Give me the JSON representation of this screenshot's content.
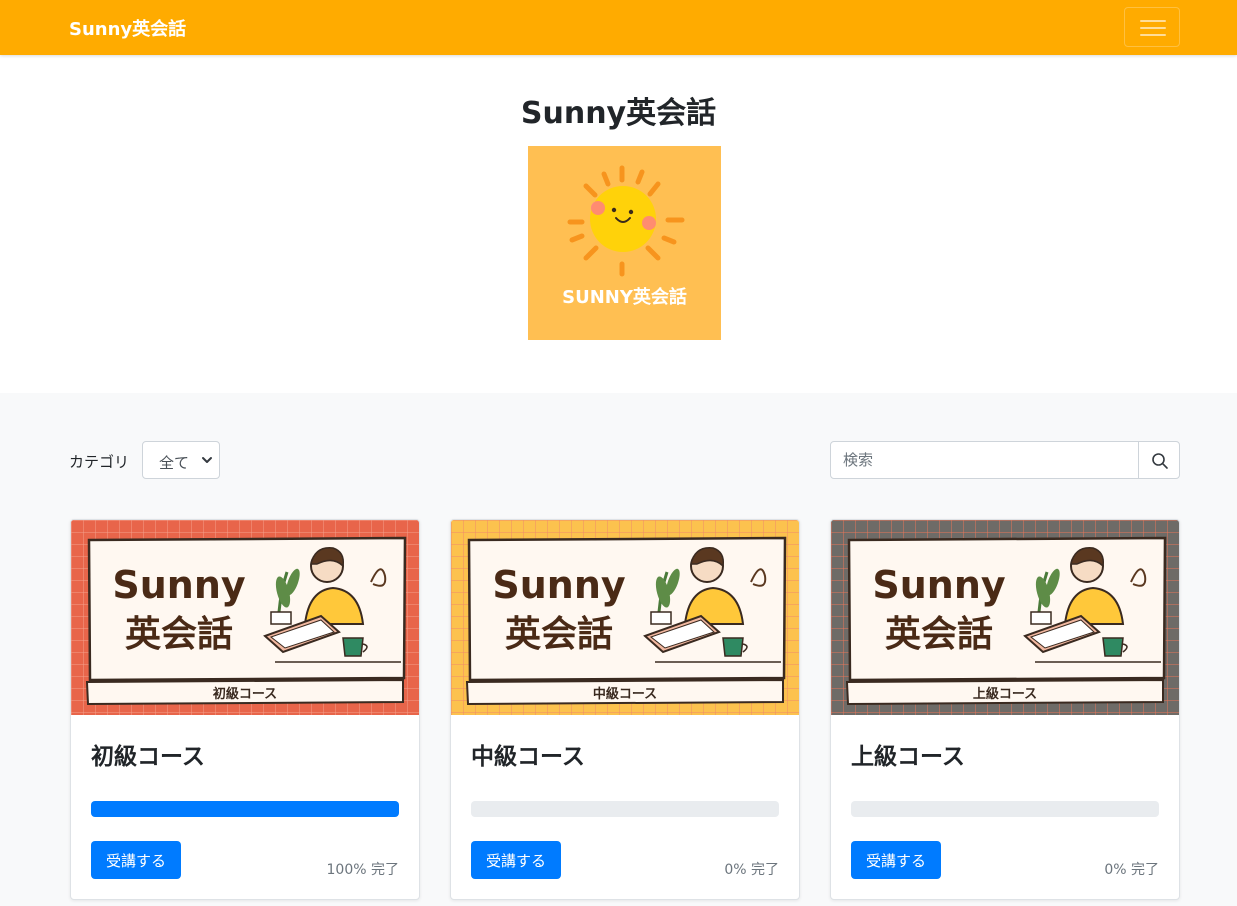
{
  "navbar": {
    "brand": "Sunny英会話",
    "bg": "#ffab00"
  },
  "hero": {
    "title": "Sunny英会話",
    "logo_text": "SUNNY英会話",
    "logo_bg": "#ffbf52"
  },
  "filter": {
    "label": "カテゴリ",
    "selected": "全て"
  },
  "search": {
    "placeholder": "検索"
  },
  "courses": [
    {
      "title": "初級コース",
      "thumb_title_line1": "Sunny",
      "thumb_title_line2": "英会話",
      "thumb_label": "初級コース",
      "thumb_bg": "#e8654a",
      "progress": 100,
      "progress_text": "100% 完了",
      "button": "受講する"
    },
    {
      "title": "中級コース",
      "thumb_title_line1": "Sunny",
      "thumb_title_line2": "英会話",
      "thumb_label": "中級コース",
      "thumb_bg": "#fcc24e",
      "progress": 0,
      "progress_text": "0% 完了",
      "button": "受講する"
    },
    {
      "title": "上級コース",
      "thumb_title_line1": "Sunny",
      "thumb_title_line2": "英会話",
      "thumb_label": "上級コース",
      "thumb_bg": "#6e6b67",
      "progress": 0,
      "progress_text": "0% 完了",
      "button": "受講する"
    }
  ],
  "colors": {
    "primary": "#007bff",
    "progress_track": "#e9ecef"
  },
  "icons": {
    "menu": "hamburger-icon",
    "search": "search-icon",
    "dropdown": "chevron-down-icon",
    "logo": "sun-face-icon"
  }
}
